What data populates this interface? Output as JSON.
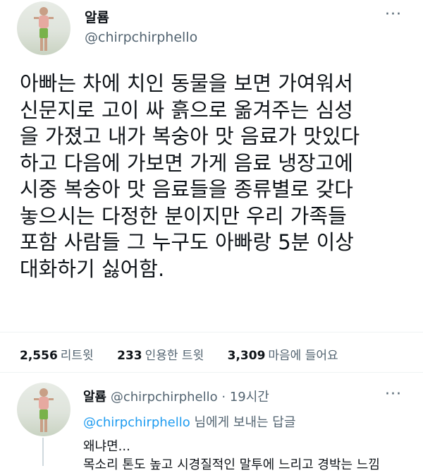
{
  "tweet": {
    "author_name": "알룜",
    "author_handle": "@chirpchirphello",
    "more_icon": "more-horizontal-icon",
    "text_lines": [
      "아빠는 차에 치인 동물을 보면 가여워서",
      "신문지로 고이 싸 흙으로 옮겨주는 심성",
      "을 가졌고 내가 복숭아 맛 음료가 맛있다",
      "하고 다음에 가보면 가게 음료 냉장고에",
      "시중 복숭아 맛  음료들을 종류별로 갖다",
      "놓으시는 다정한 분이지만 우리 가족들",
      "포함 사람들 그 누구도 아빠랑 5분 이상",
      "대화하기 싫어함."
    ],
    "stats": {
      "retweets_count": "2,556",
      "retweets_label": "리트윗",
      "quotes_count": "233",
      "quotes_label": "인용한 트윗",
      "likes_count": "3,309",
      "likes_label": "마음에 들어요"
    }
  },
  "reply": {
    "author_name": "알룜",
    "author_handle": "@chirpchirphello",
    "separator": "·",
    "time": "19시간",
    "more_icon": "more-horizontal-icon",
    "replying_to_mention": "@chirpchirphello",
    "replying_to_suffix": " 님에게 보내는 답글",
    "text_line1": "왜냐면...",
    "text_line2": "목소리 톤도 높고 시경질적인 말투에 느리고 경박는 느낌"
  },
  "colors": {
    "text": "#0f1419",
    "secondary": "#536471",
    "link": "#1d9bf0"
  }
}
